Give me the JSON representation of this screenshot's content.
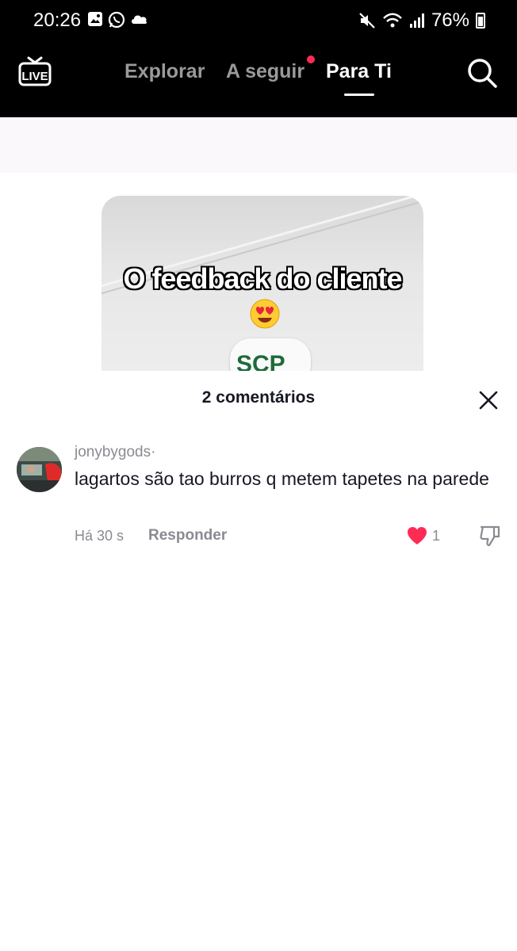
{
  "status_bar": {
    "time": "20:26",
    "battery": "76%",
    "left_icons": [
      "gallery-icon",
      "whatsapp-icon",
      "cloud-icon"
    ],
    "right_icons": [
      "mute-icon",
      "wifi-icon",
      "signal-icon",
      "battery-icon"
    ]
  },
  "nav": {
    "live_label": "LIVE",
    "tabs": [
      {
        "label": "Explorar",
        "active": false
      },
      {
        "label": "A seguir",
        "active": false,
        "has_notification_dot": true
      },
      {
        "label": "Para Ti",
        "active": true
      }
    ]
  },
  "video": {
    "caption": "O feedback do cliente",
    "emoji": "heart-eyes-emoji",
    "logo_text": "SCP"
  },
  "comments": {
    "title": "2 comentários",
    "items": [
      {
        "username": "jonybygods",
        "separator": "·",
        "text": "lagartos são tao burros q metem tapetes na parede",
        "time": "Há 30 s",
        "reply_label": "Responder",
        "likes": "1",
        "liked": true
      }
    ]
  },
  "colors": {
    "accent": "#fe2c55",
    "text_primary": "#161823",
    "text_secondary": "#8a8b91",
    "band": "#fbf8fb"
  }
}
